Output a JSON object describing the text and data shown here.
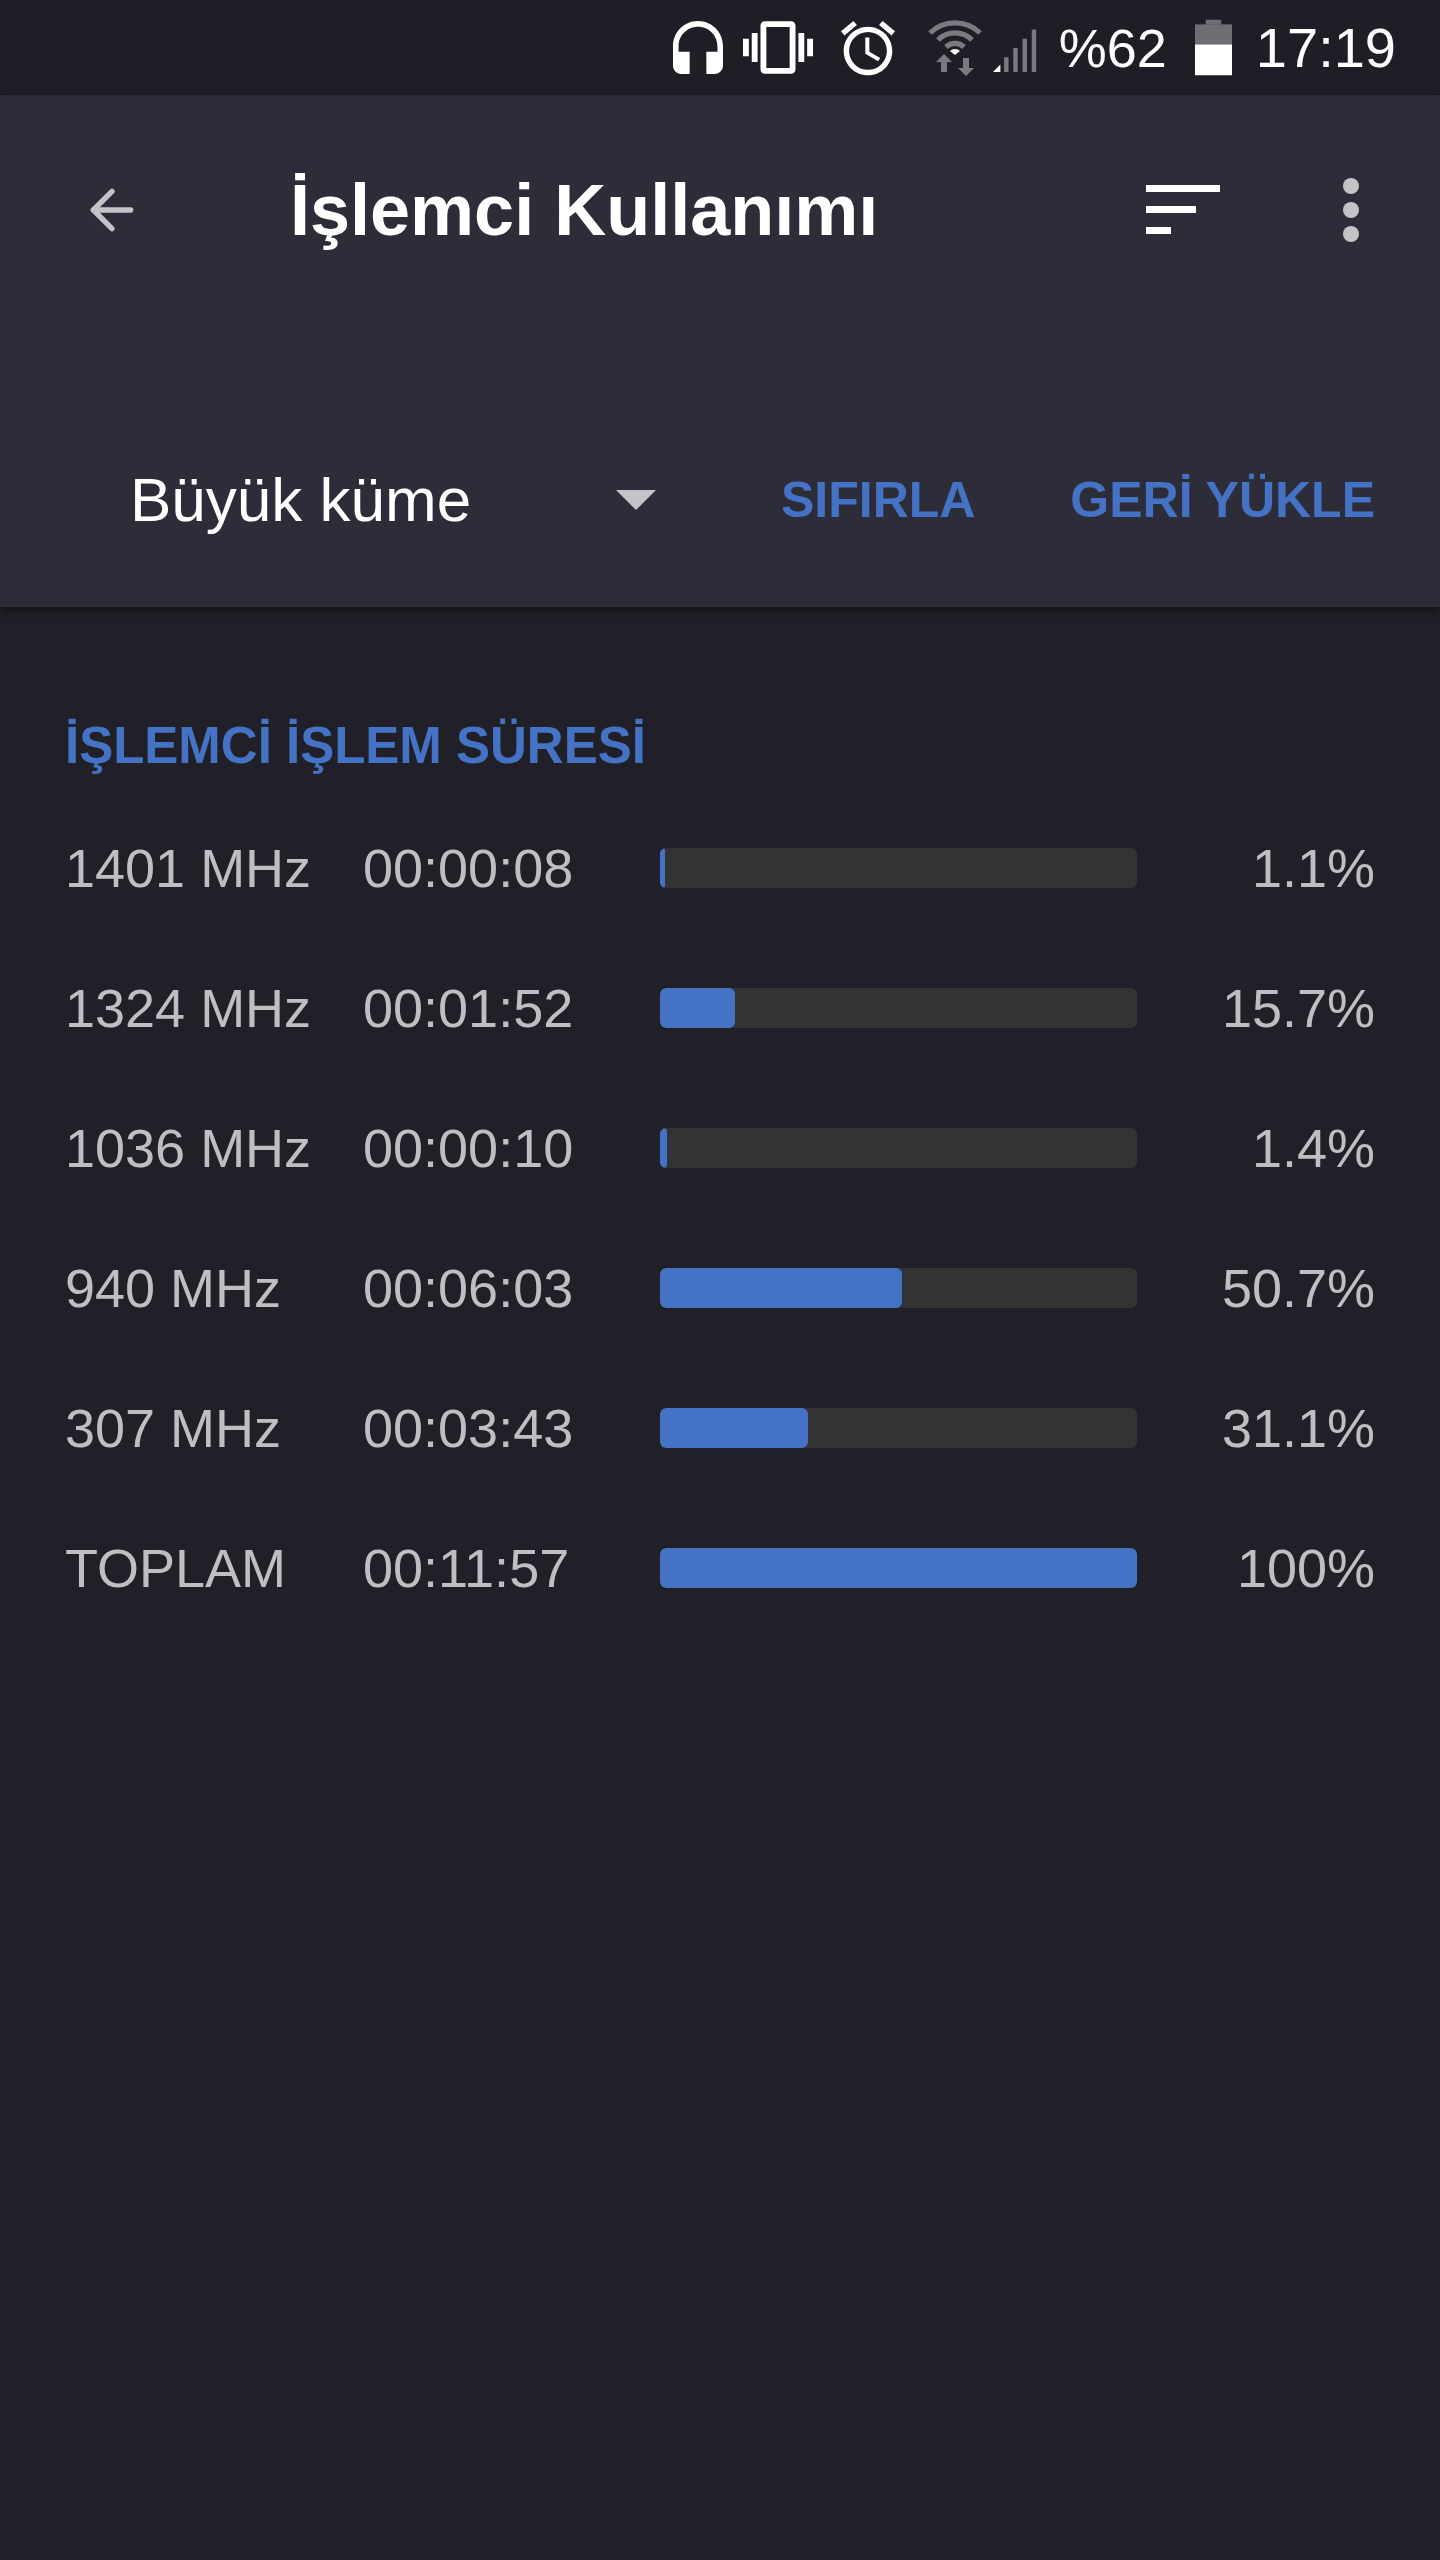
{
  "status_bar": {
    "battery": "%62",
    "time": "17:19"
  },
  "toolbar": {
    "title": "İşlemci Kullanımı"
  },
  "controls": {
    "dropdown": {
      "value": "Büyük küme"
    },
    "actions": [
      "SIFIRLA",
      "GERİ YÜKLE"
    ]
  },
  "section": {
    "title": "İŞLEMCİ İŞLEM SÜRESİ",
    "rows": [
      {
        "frequency": "1401 MHz",
        "time": "00:00:08",
        "level": 0.011,
        "percent": "1.1%"
      },
      {
        "frequency": "1324 MHz",
        "time": "00:01:52",
        "level": 0.157,
        "percent": "15.7%"
      },
      {
        "frequency": "1036 MHz",
        "time": "00:00:10",
        "level": 0.014,
        "percent": "1.4%"
      },
      {
        "frequency": "940 MHz",
        "time": "00:06:03",
        "level": 0.507,
        "percent": "50.7%"
      },
      {
        "frequency": "307 MHz",
        "time": "00:03:43",
        "level": 0.311,
        "percent": "31.1%"
      },
      {
        "frequency": "TOPLAM",
        "time": "00:11:57",
        "level": 1,
        "percent": "100%"
      }
    ]
  }
}
